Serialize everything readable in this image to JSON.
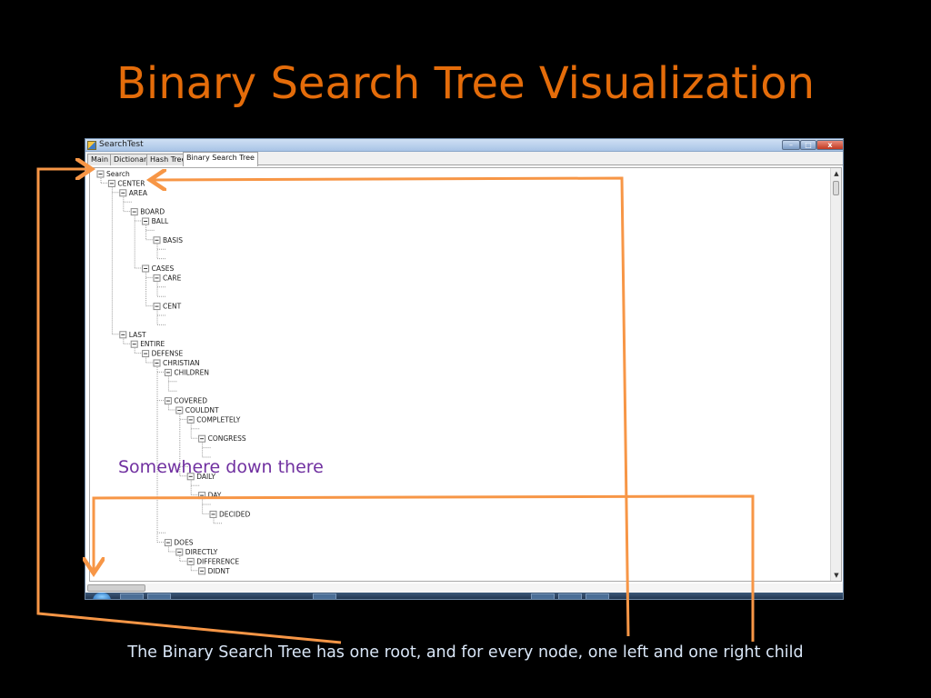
{
  "slide": {
    "title": "Binary Search Tree Visualization",
    "annotation": "Somewhere down there",
    "caption": "The Binary Search Tree has one root, and for every node, one left and one right child"
  },
  "window": {
    "title": "SearchTest",
    "controls": {
      "minimize": "–",
      "maximize": "□",
      "close": "x"
    }
  },
  "tabs": [
    {
      "label": "Main",
      "active": false
    },
    {
      "label": "Dictionary",
      "active": false
    },
    {
      "label": "Hash Tree",
      "active": false
    },
    {
      "label": "Binary Search Tree",
      "active": true
    }
  ],
  "tree": {
    "nodes": [
      {
        "label": "Search",
        "depth": 0
      },
      {
        "label": "CENTER",
        "depth": 1
      },
      {
        "label": "AREA",
        "depth": 2
      },
      {
        "label": "",
        "depth": 3
      },
      {
        "label": "BOARD",
        "depth": 3
      },
      {
        "label": "BALL",
        "depth": 4
      },
      {
        "label": "",
        "depth": 5
      },
      {
        "label": "BASIS",
        "depth": 5
      },
      {
        "label": "",
        "depth": 6
      },
      {
        "label": "",
        "depth": 6
      },
      {
        "label": "CASES",
        "depth": 4
      },
      {
        "label": "CARE",
        "depth": 5
      },
      {
        "label": "",
        "depth": 6
      },
      {
        "label": "",
        "depth": 6
      },
      {
        "label": "CENT",
        "depth": 5
      },
      {
        "label": "",
        "depth": 6
      },
      {
        "label": "",
        "depth": 6
      },
      {
        "label": "LAST",
        "depth": 2
      },
      {
        "label": "ENTIRE",
        "depth": 3
      },
      {
        "label": "DEFENSE",
        "depth": 4
      },
      {
        "label": "CHRISTIAN",
        "depth": 5
      },
      {
        "label": "CHILDREN",
        "depth": 6
      },
      {
        "label": "",
        "depth": 7
      },
      {
        "label": "",
        "depth": 7
      },
      {
        "label": "COVERED",
        "depth": 6
      },
      {
        "label": "COULDNT",
        "depth": 7
      },
      {
        "label": "COMPLETELY",
        "depth": 8
      },
      {
        "label": "",
        "depth": 9
      },
      {
        "label": "CONGRESS",
        "depth": 9
      },
      {
        "label": "",
        "depth": 10
      },
      {
        "label": "",
        "depth": 10
      },
      {
        "label": "",
        "depth": 8
      },
      {
        "label": "DAILY",
        "depth": 8
      },
      {
        "label": "",
        "depth": 9
      },
      {
        "label": "DAY",
        "depth": 9
      },
      {
        "label": "",
        "depth": 10
      },
      {
        "label": "DECIDED",
        "depth": 10
      },
      {
        "label": "",
        "depth": 11
      },
      {
        "label": "",
        "depth": 6
      },
      {
        "label": "DOES",
        "depth": 6
      },
      {
        "label": "DIRECTLY",
        "depth": 7
      },
      {
        "label": "DIFFERENCE",
        "depth": 8
      },
      {
        "label": "DIDNT",
        "depth": 9
      }
    ]
  },
  "colors": {
    "title": "#e46c0a",
    "annotation": "#7030a0",
    "arrow": "#f79646",
    "caption": "#d9e6f7",
    "tree_line": "#a0a0a0",
    "tree_text": "#202020"
  }
}
